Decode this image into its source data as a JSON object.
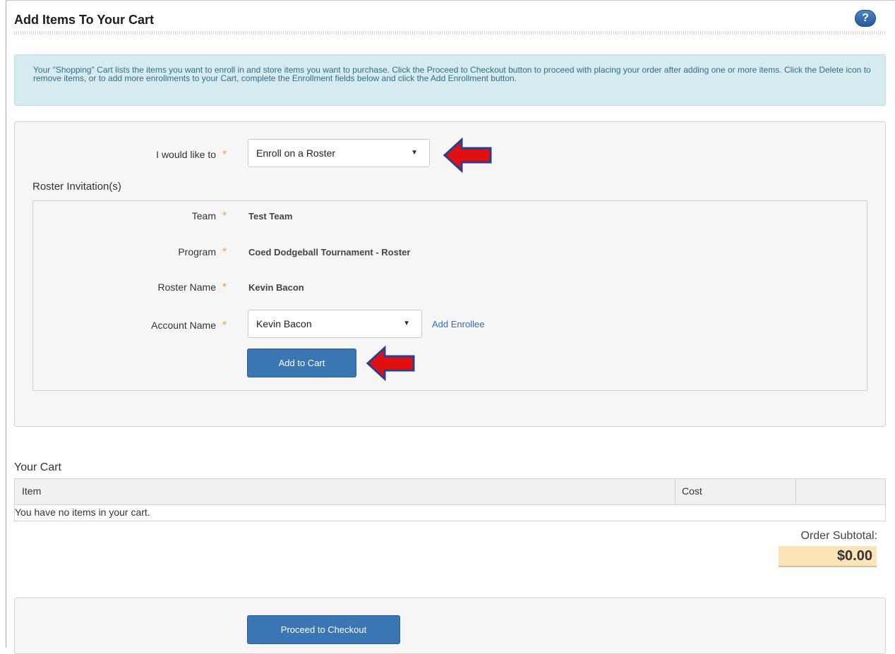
{
  "page": {
    "title": "Add Items To Your Cart",
    "help_label": "?"
  },
  "info": {
    "text": "Your \"Shopping\" Cart lists the items you want to enroll in and store items you want to purchase. Click the Proceed to Checkout button to proceed with placing your order after adding one or more items. Click the Delete icon to remove items, or to add more enrollments to your Cart, complete the Enrollment fields below and click the Add Enrollment button."
  },
  "enrollment": {
    "action_label": "I would like to",
    "action_value": "Enroll on a Roster",
    "required_mark": "*",
    "section_heading": "Roster Invitation(s)",
    "team_label": "Team",
    "team_value": "Test Team",
    "program_label": "Program",
    "program_value": "Coed Dodgeball Tournament - Roster",
    "roster_name_label": "Roster Name",
    "roster_name_value": "Kevin Bacon",
    "account_label": "Account Name",
    "account_value": "Kevin Bacon",
    "add_enrollee_link": "Add Enrollee",
    "add_to_cart_button": "Add to Cart",
    "caret": "▼"
  },
  "cart": {
    "title": "Your Cart",
    "columns": [
      "Item",
      "Cost"
    ],
    "empty_message": "You have no items in your cart.",
    "subtotal_label": "Order Subtotal:",
    "subtotal_value": "$0.00"
  },
  "checkout": {
    "button_label": "Proceed to Checkout"
  },
  "colors": {
    "primary_button": "#3a75b4",
    "info_background": "#d5ebf0",
    "required_asterisk": "#f0a040",
    "annotation_arrow": "#e01010",
    "subtotal_highlight": "#fde3b8"
  },
  "annotations": {
    "arrow_icon": "red-left-arrow"
  }
}
